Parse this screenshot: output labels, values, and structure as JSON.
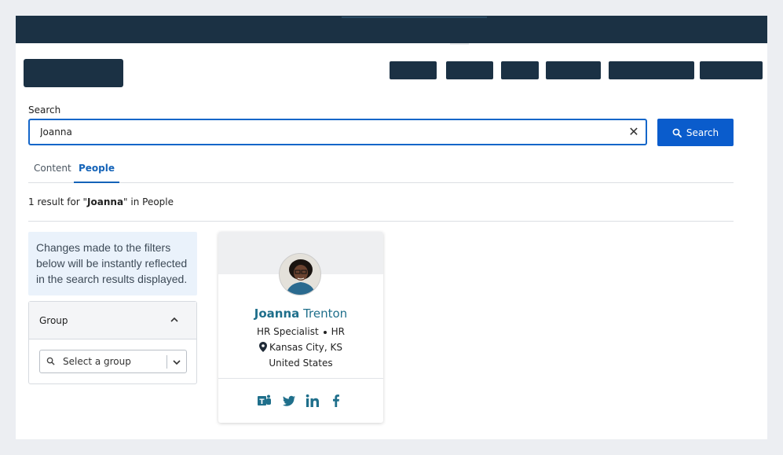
{
  "search": {
    "label": "Search",
    "value": "Joanna",
    "clear_icon": "close-icon",
    "button_label": "Search",
    "button_icon": "search-icon"
  },
  "tabs": [
    {
      "label": "Content",
      "active": false
    },
    {
      "label": "People",
      "active": true
    }
  ],
  "results": {
    "prefix": "1 result for \"",
    "query": "Joanna",
    "suffix": "\" in People"
  },
  "filters": {
    "info": "Changes made to the filters below will be instantly reflected in the search results displayed.",
    "group": {
      "title": "Group",
      "placeholder": "Select a group"
    }
  },
  "person": {
    "first_name": "Joanna",
    "last_name": "Trenton",
    "title": "HR Specialist",
    "department": "HR",
    "city": "Kansas City, KS",
    "country": "United States",
    "social": [
      "teams-icon",
      "twitter-icon",
      "linkedin-icon",
      "facebook-icon"
    ]
  },
  "colors": {
    "header": "#1b3144",
    "accent": "#0a5ccc",
    "name": "#1f6f8b",
    "info_bg": "#eaf2fb"
  }
}
